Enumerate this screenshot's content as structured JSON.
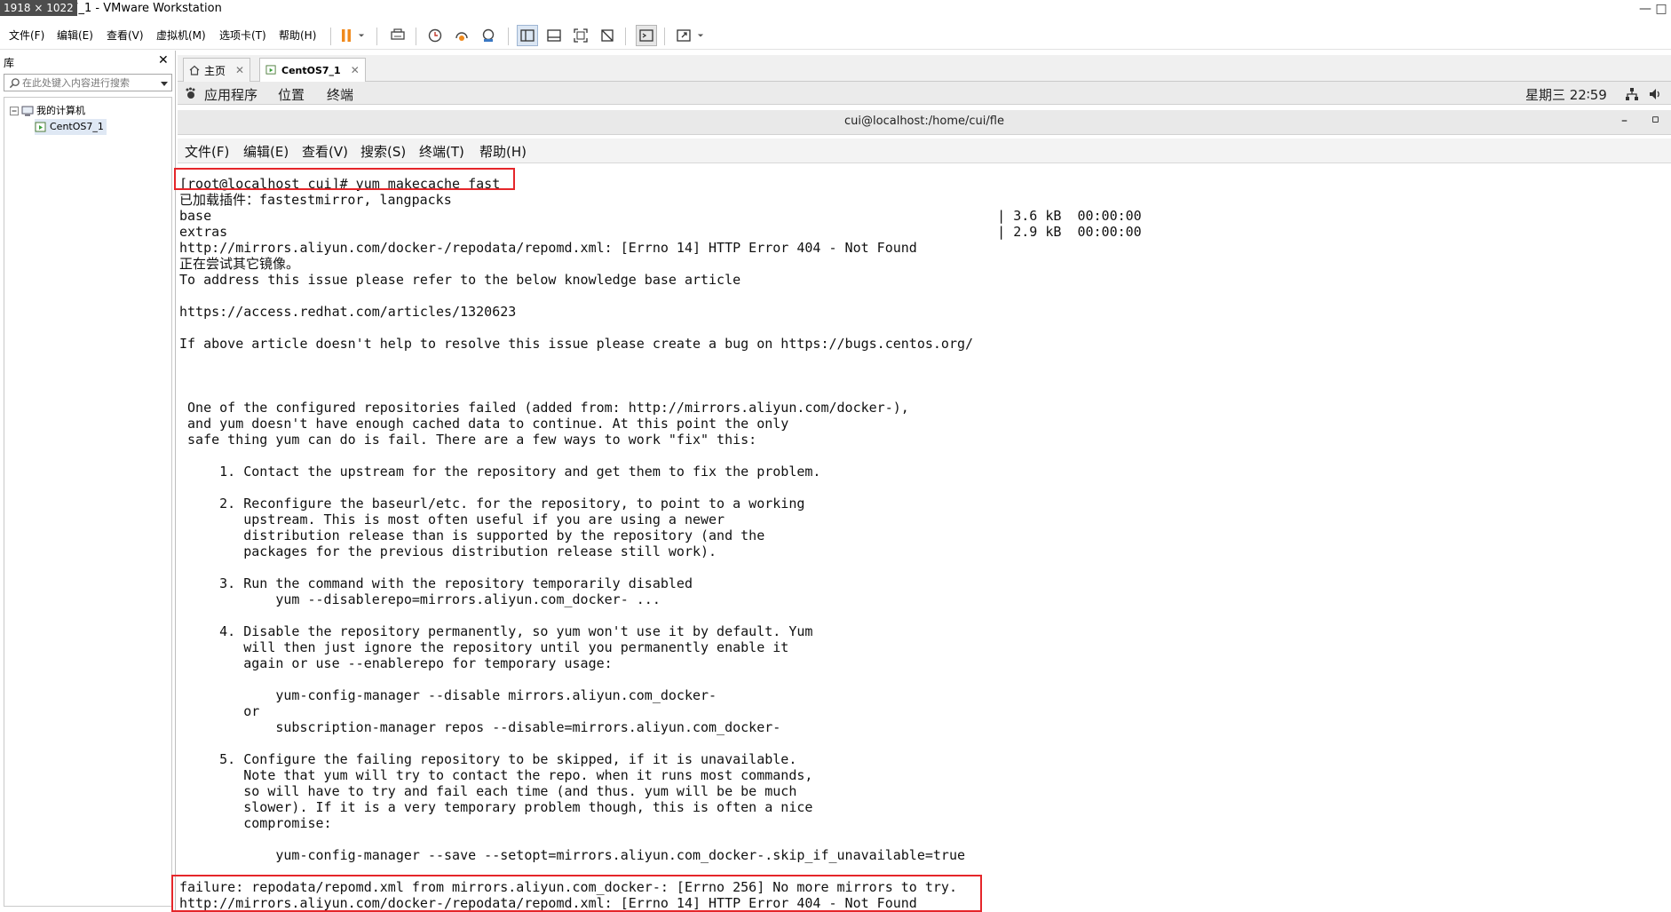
{
  "window": {
    "size_badge": "1918 × 1022",
    "title": "S7_1 - VMware Workstation",
    "controls": {
      "minimize": "—",
      "restore": "□"
    }
  },
  "vmware_menu": [
    "文件(F)",
    "编辑(E)",
    "查看(V)",
    "虚拟机(M)",
    "选项卡(T)",
    "帮助(H)"
  ],
  "library": {
    "title": "库",
    "close": "✕",
    "search_placeholder": "在此处键入内容进行搜索",
    "tree": {
      "root": "我的计算机",
      "vm": "CentOS7_1"
    }
  },
  "tabs": [
    {
      "label": "主页",
      "close": "✕"
    },
    {
      "label": "CentOS7_1",
      "close": "✕"
    }
  ],
  "gnome": {
    "menus": [
      "应用程序",
      "位置",
      "终端"
    ],
    "clock": "星期三 22∶59"
  },
  "terminal": {
    "title": "cui@localhost:/home/cui/fle",
    "title_controls": {
      "minimize": "–",
      "maximize": "▫"
    },
    "menus": [
      "文件(F)",
      "编辑(E)",
      "查看(V)",
      "搜索(S)",
      "终端(T)",
      "帮助(H)"
    ],
    "lines": [
      "[root@localhost cui]# yum makecache fast",
      "已加载插件：fastestmirror, langpacks",
      "base                                                                                                  | 3.6 kB  00:00:00",
      "extras                                                                                                | 2.9 kB  00:00:00",
      "http://mirrors.aliyun.com/docker-/repodata/repomd.xml: [Errno 14] HTTP Error 404 - Not Found",
      "正在尝试其它镜像。",
      "To address this issue please refer to the below knowledge base article",
      "",
      "https://access.redhat.com/articles/1320623",
      "",
      "If above article doesn't help to resolve this issue please create a bug on https://bugs.centos.org/",
      "",
      "",
      "",
      " One of the configured repositories failed (added from: http://mirrors.aliyun.com/docker-),",
      " and yum doesn't have enough cached data to continue. At this point the only",
      " safe thing yum can do is fail. There are a few ways to work \"fix\" this:",
      "",
      "     1. Contact the upstream for the repository and get them to fix the problem.",
      "",
      "     2. Reconfigure the baseurl/etc. for the repository, to point to a working",
      "        upstream. This is most often useful if you are using a newer",
      "        distribution release than is supported by the repository (and the",
      "        packages for the previous distribution release still work).",
      "",
      "     3. Run the command with the repository temporarily disabled",
      "            yum --disablerepo=mirrors.aliyun.com_docker- ...",
      "",
      "     4. Disable the repository permanently, so yum won't use it by default. Yum",
      "        will then just ignore the repository until you permanently enable it",
      "        again or use --enablerepo for temporary usage:",
      "",
      "            yum-config-manager --disable mirrors.aliyun.com_docker-",
      "        or",
      "            subscription-manager repos --disable=mirrors.aliyun.com_docker-",
      "",
      "     5. Configure the failing repository to be skipped, if it is unavailable.",
      "        Note that yum will try to contact the repo. when it runs most commands,",
      "        so will have to try and fail each time (and thus. yum will be be much",
      "        slower). If it is a very temporary problem though, this is often a nice",
      "        compromise:",
      "",
      "            yum-config-manager --save --setopt=mirrors.aliyun.com_docker-.skip_if_unavailable=true",
      "",
      "failure: repodata/repomd.xml from mirrors.aliyun.com_docker-: [Errno 256] No more mirrors to try.",
      "http://mirrors.aliyun.com/docker-/repodata/repomd.xml: [Errno 14] HTTP Error 404 - Not Found"
    ]
  },
  "colors": {
    "highlight": "#e5262a",
    "pause_orange": "#f08a1c"
  }
}
